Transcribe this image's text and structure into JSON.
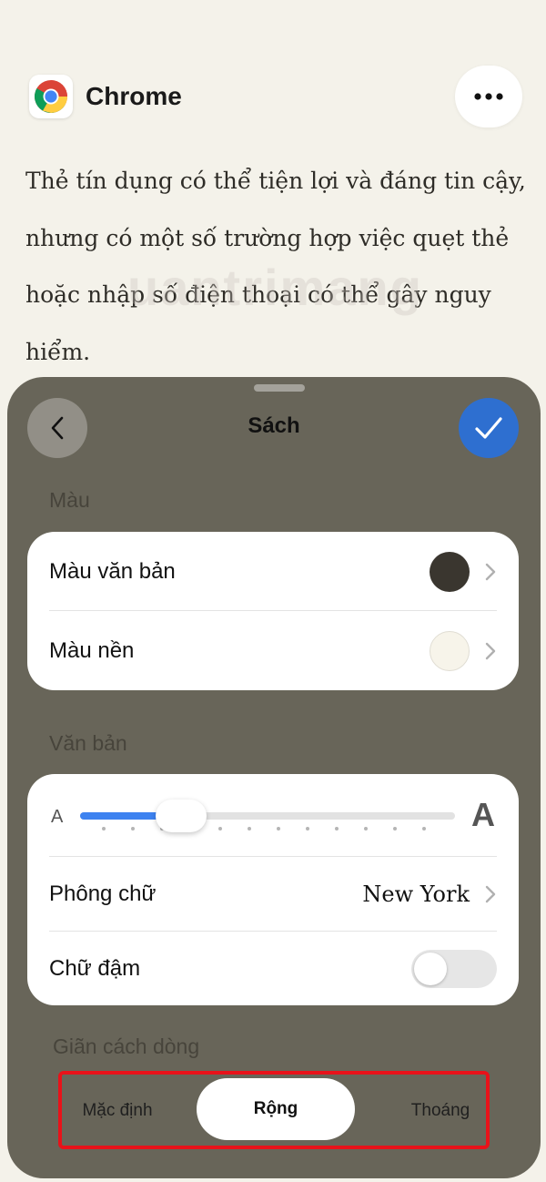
{
  "app": {
    "name": "Chrome",
    "more_label": "•••"
  },
  "article": {
    "text": "Thẻ tín dụng có thể tiện lợi và đáng tin cậy, nhưng có một số trường hợp việc quẹt thẻ hoặc nhập số điện thoại có thể gây nguy hiểm."
  },
  "watermark": "uantrimang",
  "sheet": {
    "title": "Sách",
    "color_section": {
      "label": "Màu",
      "rows": [
        {
          "label": "Màu văn bản",
          "swatch": "#3a362f"
        },
        {
          "label": "Màu nền",
          "swatch": "#f7f4ea"
        }
      ]
    },
    "text_section": {
      "label": "Văn bản",
      "slider": {
        "small_label": "A",
        "large_label": "A",
        "value": 0.27,
        "steps": 12
      },
      "font_row": {
        "label": "Phông chữ",
        "value": "New York"
      },
      "bold_row": {
        "label": "Chữ đậm",
        "enabled": false
      }
    },
    "spacing_section": {
      "label": "Giãn cách dòng",
      "options": [
        "Mặc định",
        "Rộng",
        "Thoáng"
      ],
      "selected": "Rộng"
    }
  },
  "colors": {
    "accent": "#2e6fd0",
    "slider_fill": "#3d82f0",
    "highlight_box": "#e8121a"
  }
}
